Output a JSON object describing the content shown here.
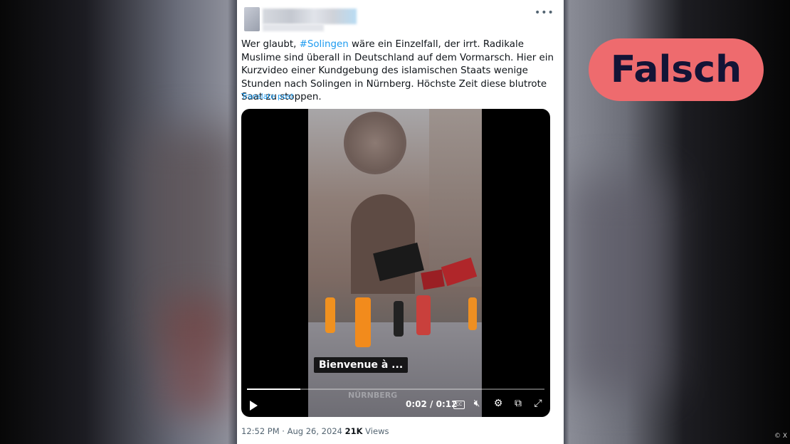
{
  "post": {
    "text_before": "Wer glaubt, ",
    "hashtag": "#Solingen",
    "text_after": " wäre ein Einzelfall, der irrt. Radikale Muslime sind überall in Deutschland auf dem Vormarsch. Hier ein Kurzvideo einer Kundgebung des islamischen Staats wenige Stunden nach Solingen in Nürnberg. Höchste Zeit diese blutrote Saat zu stoppen.",
    "translate_label": "Translate post",
    "more_label": "•••",
    "time": "12:52 PM",
    "separator": " · ",
    "date": "Aug 26, 2024",
    "views_count": "21K",
    "views_label": " Views"
  },
  "video": {
    "caption": "Bienvenue à ...",
    "watermark": "NÜRNBERG",
    "current_time": "0:02",
    "time_separator": " / ",
    "duration": "0:12",
    "progress_fraction": 0.18,
    "cc_label": "CC"
  },
  "verdict": {
    "label": "Falsch",
    "color": "#ee6b6e"
  },
  "credit": "© X"
}
